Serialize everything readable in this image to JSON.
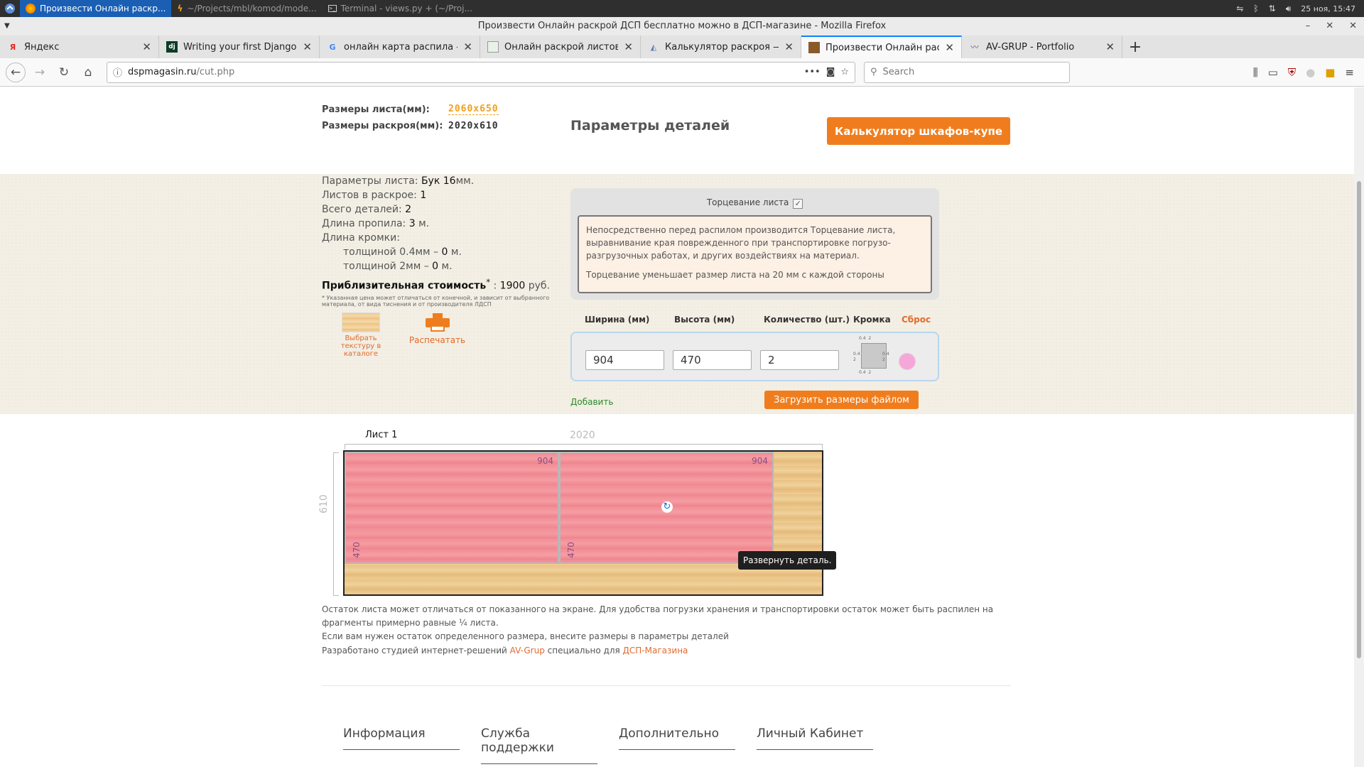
{
  "system_panel": {
    "tasks": [
      {
        "label": "Произвести Онлайн раскр...",
        "active": true
      },
      {
        "label": "~/Projects/mbl/komod/mode...",
        "active": false
      },
      {
        "label": "Terminal - views.py + (~/Proj...",
        "active": false
      }
    ],
    "clock": "25 ноя, 15:47"
  },
  "window": {
    "title": "Произвести Онлайн раскрой ДСП бесплатно можно в ДСП-магазине - Mozilla Firefox"
  },
  "tabs": [
    {
      "label": "Яндекс",
      "icon": "yandex-icon",
      "active": false
    },
    {
      "label": "Writing your first Django app,",
      "icon": "django-icon",
      "active": false
    },
    {
      "label": "онлайн карта распила - Пои",
      "icon": "google-icon",
      "active": false
    },
    {
      "label": "Онлайн раскрой листовых м",
      "icon": "page-icon",
      "active": false
    },
    {
      "label": "Калькулятор раскроя — TBL",
      "icon": "page-icon",
      "active": false
    },
    {
      "label": "Произвести Онлайн раскрой",
      "icon": "site-icon",
      "active": true
    },
    {
      "label": "AV-GRUP - Portfolio",
      "icon": "portfolio-icon",
      "active": false
    }
  ],
  "urlbar": {
    "host": "dspmagasin.ru",
    "path": "/cut.php"
  },
  "searchbar": {
    "placeholder": "Search"
  },
  "sheet_info": {
    "sheet_size_label": "Размеры листа(мм):",
    "sheet_size_value": "2060x650",
    "cut_size_label": "Размеры раскроя(мм):",
    "cut_size_value": "2020x610",
    "details_heading": "Параметры деталей",
    "wardrobe_button": "Калькулятор шкафов-купе"
  },
  "summary": {
    "material_label": "Параметры листа:",
    "material_value": "Бук 16",
    "material_unit": "мм.",
    "sheets_label": "Листов в раскрое:",
    "sheets_value": "1",
    "details_label": "Всего деталей:",
    "details_value": "2",
    "kerf_label": "Длина пропила:",
    "kerf_value": "3",
    "kerf_unit": "м.",
    "edge_label": "Длина кромки:",
    "edge_thin_label": "толщиной 0.4мм –",
    "edge_thin_value": "0",
    "edge_thin_unit": "м.",
    "edge_thick_label": "толщиной 2мм –",
    "edge_thick_value": "0",
    "edge_thick_unit": "м.",
    "cost_label": "Приблизительная стоимость",
    "cost_star": "*",
    "cost_value": "1900",
    "cost_unit": "руб.",
    "cost_note": "* Указанная цена может отличаться от конечной, и зависит от выбранного материала, от вида тиснения и от производителя ЛДСП",
    "texture_link": "Выбрать текстуру в каталоге",
    "print_link": "Распечатать"
  },
  "trim": {
    "label": "Торцевание листа",
    "checked": true,
    "notice_1": "Непосредственно перед распилом производится Торцевание листа, выравнивание края поврежденного при транспортировке погрузо-разгрузочных работах, и других воздействиях на материал.",
    "notice_2": "Торцевание уменьшает размер листа на 20 мм с каждой стороны"
  },
  "details_form": {
    "col_width": "Ширина (мм)",
    "col_height": "Высота (мм)",
    "col_qty": "Количество (шт.)",
    "col_edge": "Кромка",
    "reset": "Сброс",
    "width_value": "904",
    "height_value": "470",
    "qty_value": "2",
    "edge_top_labels": [
      "0.4",
      "2"
    ],
    "edge_bottom_labels": [
      "0.4",
      "2"
    ],
    "edge_left_labels": [
      "0.4",
      "2"
    ],
    "edge_right_labels": [
      "0.4",
      "2"
    ],
    "add_link": "Добавить",
    "upload_button": "Загрузить размеры файлом"
  },
  "layout_view": {
    "sheet_title": "Лист 1",
    "sheet_width_label": "2020",
    "sheet_height_label": "610",
    "pieces": [
      {
        "width": "904",
        "height": "470"
      },
      {
        "width": "904",
        "height": "470"
      }
    ],
    "tooltip": "Развернуть деталь."
  },
  "notes": {
    "remainder_1": "Остаток листа может отличаться от показанного на экране. Для удобства погрузки хранения и транспортировки остаток может быть распилен на фрагменты примерно равные ¼ листа.",
    "remainder_2": "Если вам нужен остаток определенного размера, внесите размеры в параметры деталей",
    "credit_prefix": "Разработано студией интернет-решений",
    "credit_studio": "AV-Grup",
    "credit_middle": "специально для",
    "credit_shop": "ДСП-Магазина"
  },
  "footer": {
    "columns": [
      "Информация",
      "Служба поддержки",
      "Дополнительно",
      "Личный Кабинет"
    ]
  },
  "colors": {
    "accent_orange": "#f07d1d",
    "link_orange": "#e06b2d",
    "piece_pink": "#f38096",
    "firefox_blue": "#0a84ff"
  }
}
